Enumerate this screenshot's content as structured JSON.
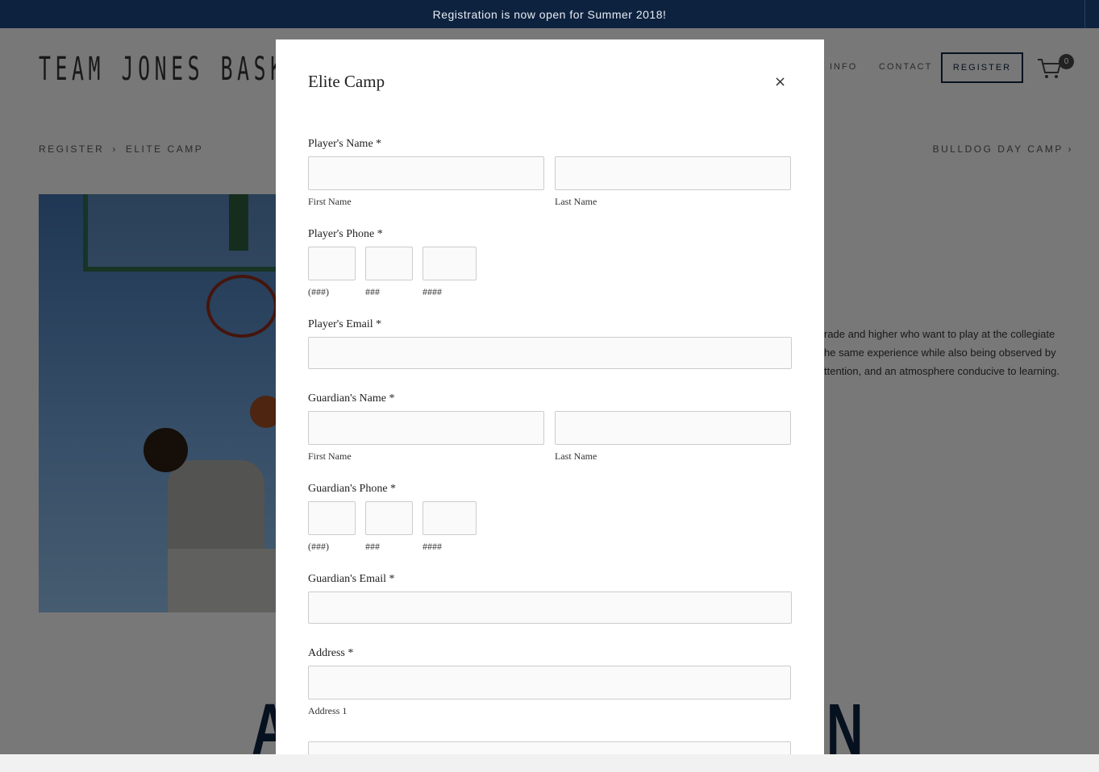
{
  "announcement": "Registration is now open for Summer 2018!",
  "site": {
    "logo": "TEAM JONES BASKE",
    "nav": [
      {
        "label": "INFO"
      },
      {
        "label": "CONTACT"
      }
    ],
    "register_label": "REGISTER",
    "cart_count": "0",
    "breadcrumb": {
      "root": "REGISTER",
      "sep": "›",
      "current": "ELITE CAMP"
    },
    "next_link": "BULLDOG DAY CAMP ›",
    "description_lines": [
      "rade and higher who want to play at the collegiate",
      "he same experience while also being observed by",
      "ttention, and an atmosphere conducive to learning."
    ],
    "big_left": "A",
    "big_right": "N"
  },
  "modal": {
    "title": "Elite Camp",
    "close": "×",
    "player_name": {
      "label": "Player's Name *",
      "first": "First Name",
      "last": "Last Name"
    },
    "player_phone": {
      "label": "Player's Phone *",
      "area": "(###)",
      "prefix": "###",
      "line": "####"
    },
    "player_email": {
      "label": "Player's Email *"
    },
    "guardian_name": {
      "label": "Guardian's Name *",
      "first": "First Name",
      "last": "Last Name"
    },
    "guardian_phone": {
      "label": "Guardian's Phone *",
      "area": "(###)",
      "prefix": "###",
      "line": "####"
    },
    "guardian_email": {
      "label": "Guardian's Email *"
    },
    "address": {
      "label": "Address *",
      "line1": "Address 1"
    }
  }
}
